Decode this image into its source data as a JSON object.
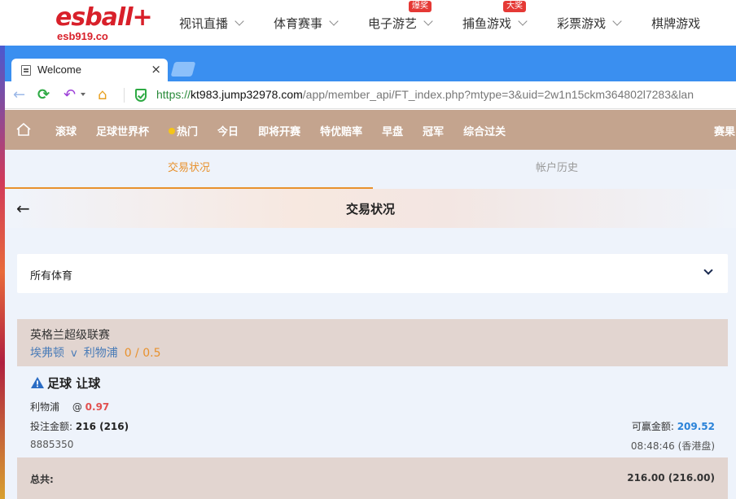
{
  "site": {
    "logo_main": "esball+",
    "logo_sub": "esb919.co",
    "nav": [
      {
        "label": "视讯直播",
        "badge": ""
      },
      {
        "label": "体育赛事",
        "badge": ""
      },
      {
        "label": "电子游艺",
        "badge": "爆奖"
      },
      {
        "label": "捕鱼游戏",
        "badge": "大奖"
      },
      {
        "label": "彩票游戏",
        "badge": ""
      },
      {
        "label": "棋牌游戏",
        "badge": ""
      }
    ]
  },
  "browser": {
    "tab_title": "Welcome",
    "tab_close": "×",
    "url_proto": "https://",
    "url_host": "kt983.jump32978.com",
    "url_path": "/app/member_api/FT_index.php?mtype=3&uid=2w1n15ckm364802l7283&lan"
  },
  "sports_nav": {
    "items": [
      "滚球",
      "足球世界杯",
      "热门",
      "今日",
      "即将开赛",
      "特优赔率",
      "早盘",
      "冠军",
      "综合过关"
    ],
    "more": "赛果"
  },
  "sub_tabs": {
    "active": "交易状况",
    "inactive": "帐户历史"
  },
  "page": {
    "title": "交易状况",
    "back": "←"
  },
  "filter": {
    "selected": "所有体育"
  },
  "bet": {
    "league": "英格兰超级联赛",
    "home": "埃弗顿",
    "vs": "v",
    "away": "利物浦",
    "handicap": "0 / 0.5",
    "type": "足球 让球",
    "selection": "利物浦",
    "at": "@",
    "odds": "0.97",
    "stake_label": "投注金额:",
    "stake_value": "216 (216)",
    "win_label": "可赢金额:",
    "win_value": "209.52",
    "ticket_id": "8885350",
    "time": "08:48:46 (香港盘)",
    "total_label": "总共:",
    "total_value": "216.00 (216.00)"
  },
  "colors": {
    "accent": "#e8912d",
    "nav_bg": "#c4a48e",
    "browser_blue": "#3a8ff0",
    "win_blue": "#2a82d8",
    "odds_red": "#e25050",
    "logo_red": "#d8202a"
  }
}
